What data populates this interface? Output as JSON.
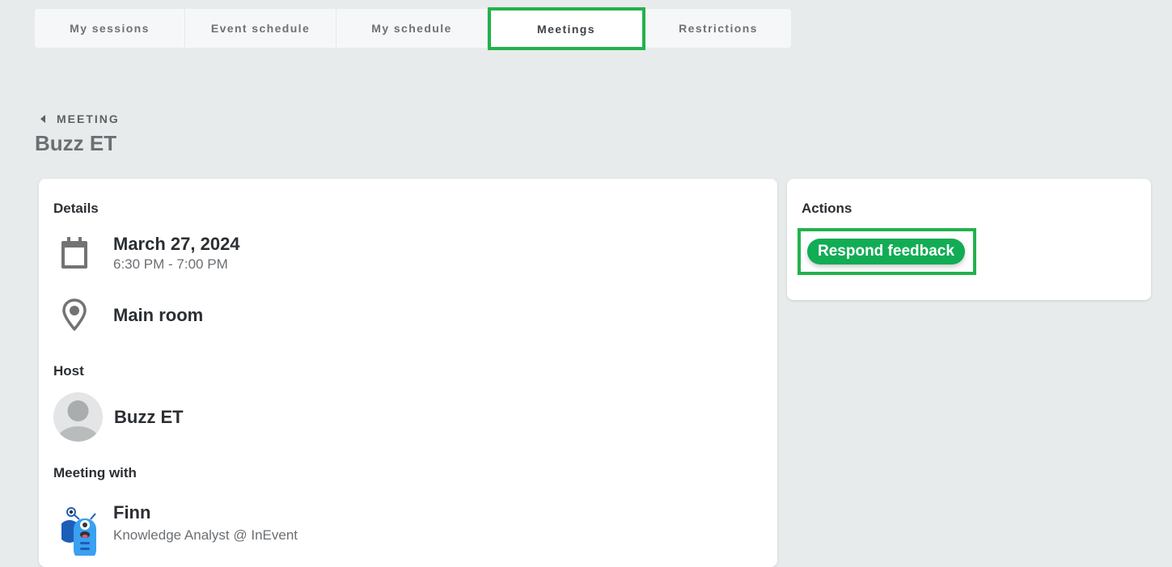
{
  "tabs": [
    {
      "label": "My sessions",
      "active": false
    },
    {
      "label": "Event schedule",
      "active": false
    },
    {
      "label": "My schedule",
      "active": false
    },
    {
      "label": "Meetings",
      "active": true
    },
    {
      "label": "Restrictions",
      "active": false
    }
  ],
  "breadcrumb": {
    "label": "MEETING"
  },
  "page": {
    "title": "Buzz ET"
  },
  "details": {
    "heading": "Details",
    "date": "March 27, 2024",
    "time": "6:30 PM - 7:00 PM",
    "location": "Main room"
  },
  "host": {
    "heading": "Host",
    "name": "Buzz ET"
  },
  "meeting_with": {
    "heading": "Meeting with",
    "name": "Finn",
    "role": "Knowledge Analyst @ InEvent"
  },
  "actions": {
    "heading": "Actions",
    "respond_feedback_label": "Respond feedback"
  },
  "colors": {
    "accent": "#12ac55",
    "highlight": "#22b24c",
    "background": "#e8ebec"
  }
}
